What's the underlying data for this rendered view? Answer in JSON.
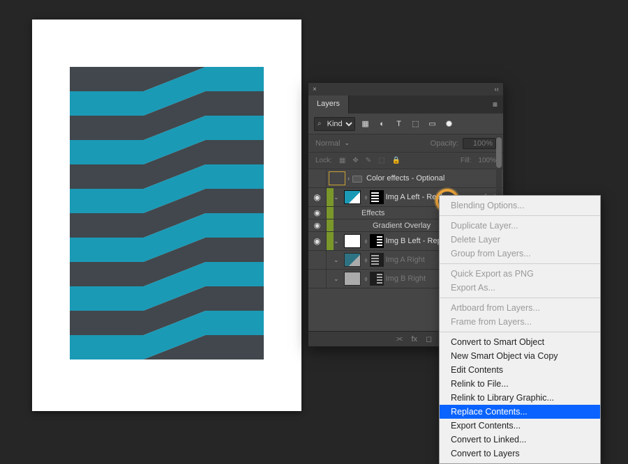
{
  "colors": {
    "teal": "#1b9ab6",
    "dark_stripe": "#41474c",
    "canvas_bg": "#262626",
    "panel_bg": "#454545",
    "highlight_blue": "#0a63ff",
    "ring": "#f3a93c"
  },
  "canvas": {
    "left_stripes": [
      "dark",
      "teal",
      "dark",
      "teal",
      "dark",
      "teal",
      "dark",
      "teal",
      "dark",
      "teal",
      "dark",
      "teal"
    ],
    "right_stripes": [
      "teal",
      "dark",
      "teal",
      "dark",
      "teal",
      "dark",
      "teal",
      "dark",
      "teal",
      "dark",
      "teal",
      "dark"
    ]
  },
  "panel": {
    "title_tab": "Layers",
    "filter": {
      "search_glyph": "⌕",
      "kind_label": "Kind"
    },
    "filter_icons": [
      "image-icon",
      "adjustment-icon",
      "type-icon",
      "shape-icon",
      "smartobj-icon",
      "dot-toggle"
    ],
    "blend_row": {
      "mode_label": "Normal",
      "opacity_label": "Opacity:",
      "opacity_value": "100%"
    },
    "lock_row": {
      "label": "Lock:",
      "fill_label": "Fill:",
      "fill_value": "100%"
    },
    "rows": [
      {
        "id": "color-effects",
        "name": "Color effects - Optional",
        "vis": false,
        "chip": "gold",
        "type": "group"
      },
      {
        "id": "img-a-left",
        "name": "Img A Left - Replace me",
        "vis": true,
        "chip": "green",
        "type": "smart",
        "selected": true,
        "fx": true
      },
      {
        "id": "effects-label",
        "name": "Effects",
        "type": "fx-head"
      },
      {
        "id": "grad-overlay",
        "name": "Gradient Overlay",
        "type": "fx-item"
      },
      {
        "id": "img-b-left",
        "name": "Img B Left - Replace me",
        "vis": true,
        "chip": "green",
        "type": "smart-b"
      },
      {
        "id": "img-a-right",
        "name": "Img A Right",
        "vis": false,
        "chip": "none",
        "type": "smart",
        "dim": true
      },
      {
        "id": "img-b-right",
        "name": "Img B Right",
        "vis": false,
        "chip": "none",
        "type": "smart-b",
        "dim": true
      }
    ],
    "bottom_icons": [
      "link-icon",
      "fx-icon",
      "mask-icon",
      "adjust-icon",
      "group-icon",
      "new-icon",
      "trash-icon"
    ]
  },
  "context_menu": {
    "groups": [
      [
        {
          "label": "Blending Options...",
          "enabled": false
        }
      ],
      [
        {
          "label": "Duplicate Layer...",
          "enabled": false
        },
        {
          "label": "Delete Layer",
          "enabled": false
        },
        {
          "label": "Group from Layers...",
          "enabled": false
        }
      ],
      [
        {
          "label": "Quick Export as PNG",
          "enabled": false
        },
        {
          "label": "Export As...",
          "enabled": false
        }
      ],
      [
        {
          "label": "Artboard from Layers...",
          "enabled": false
        },
        {
          "label": "Frame from Layers...",
          "enabled": false
        }
      ],
      [
        {
          "label": "Convert to Smart Object",
          "enabled": true
        },
        {
          "label": "New Smart Object via Copy",
          "enabled": true
        },
        {
          "label": "Edit Contents",
          "enabled": true
        },
        {
          "label": "Relink to File...",
          "enabled": true
        },
        {
          "label": "Relink to Library Graphic...",
          "enabled": true
        },
        {
          "label": "Replace Contents...",
          "enabled": true,
          "selected": true
        },
        {
          "label": "Export Contents...",
          "enabled": true
        },
        {
          "label": "Convert to Linked...",
          "enabled": true
        },
        {
          "label": "Convert to Layers",
          "enabled": true
        }
      ]
    ]
  },
  "glyphs": {
    "eye": "◉",
    "close": "×",
    "collapse": "‹‹",
    "menu": "≡",
    "caret_down": "⌄",
    "caret_right": "›",
    "image": "▦",
    "adjust": "◐",
    "type": "T",
    "shape": "⬚",
    "smart": "▭",
    "link": "⬨",
    "trash": "🗑",
    "fx": "fx",
    "chain": "⫘",
    "new": "⊞",
    "folder": "▢",
    "mask": "◻",
    "fill": "◆"
  }
}
